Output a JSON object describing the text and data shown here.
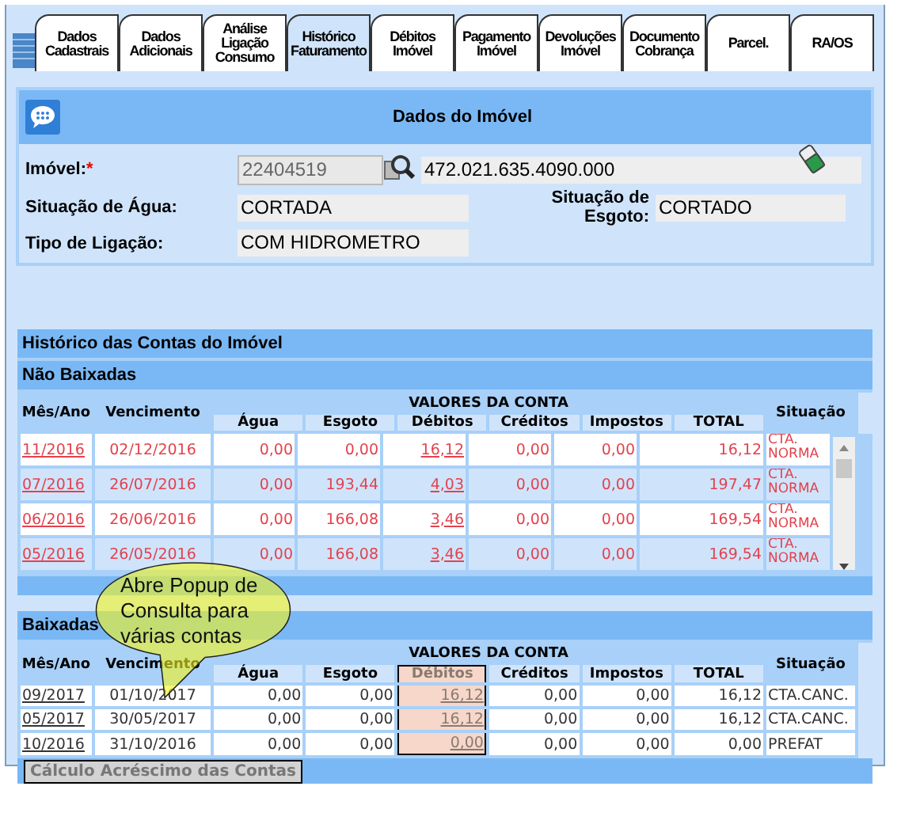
{
  "tabs": [
    {
      "label": "Dados\nCadastrais",
      "selected": false
    },
    {
      "label": "Dados\nAdicionais",
      "selected": false
    },
    {
      "label": "Análise\nLigação\nConsumo",
      "selected": false
    },
    {
      "label": "Histórico\nFaturamento",
      "selected": true
    },
    {
      "label": "Débitos\nImóvel",
      "selected": false
    },
    {
      "label": "Pagamento\nImóvel",
      "selected": false
    },
    {
      "label": "Devoluções\nImóvel",
      "selected": false
    },
    {
      "label": "Documento\nCobrança",
      "selected": false
    },
    {
      "label": "Parcel.",
      "selected": false
    },
    {
      "label": "RA/OS",
      "selected": false
    }
  ],
  "property": {
    "title": "Dados do Imóvel",
    "imovel": {
      "label": "Imóvel:",
      "required_mark": "*",
      "code": "22404519",
      "address": "472.021.635.4090.000"
    },
    "agua": {
      "label": "Situação de Água:",
      "value": "CORTADA"
    },
    "esgoto": {
      "label": "Situação de Esgoto:",
      "value": "CORTADO"
    },
    "ligacao": {
      "label": "Tipo de Ligação:",
      "value": "COM HIDROMETRO"
    }
  },
  "history": {
    "title": "Histórico das Contas do Imóvel",
    "sections": [
      {
        "title": "Não Baixadas",
        "kind": "pending",
        "group_label": "VALORES DA CONTA",
        "columns": [
          {
            "label": "Mês/Ano",
            "kind": "period",
            "highlighted": false
          },
          {
            "label": "Vencimento",
            "kind": "date",
            "highlighted": false
          },
          {
            "label": "Água",
            "kind": "amount",
            "highlighted": false
          },
          {
            "label": "Esgoto",
            "kind": "amount",
            "highlighted": false
          },
          {
            "label": "Débitos",
            "kind": "link_amount",
            "highlighted": false
          },
          {
            "label": "Créditos",
            "kind": "amount",
            "highlighted": false
          },
          {
            "label": "Impostos",
            "kind": "amount",
            "highlighted": false
          },
          {
            "label": "TOTAL",
            "kind": "amount",
            "highlighted": false
          },
          {
            "label": "Situação",
            "kind": "status",
            "highlighted": false
          }
        ],
        "rows": [
          {
            "cells": [
              "11/2016",
              "02/12/2016",
              "0,00",
              "0,00",
              "16,12",
              "0,00",
              "0,00",
              "16,12",
              "CTA. NORMA"
            ]
          },
          {
            "cells": [
              "07/2016",
              "26/07/2016",
              "0,00",
              "193,44",
              "4,03",
              "0,00",
              "0,00",
              "197,47",
              "CTA. NORMA"
            ]
          },
          {
            "cells": [
              "06/2016",
              "26/06/2016",
              "0,00",
              "166,08",
              "3,46",
              "0,00",
              "0,00",
              "169,54",
              "CTA. NORMA"
            ]
          },
          {
            "cells": [
              "05/2016",
              "26/05/2016",
              "0,00",
              "166,08",
              "3,46",
              "0,00",
              "0,00",
              "169,54",
              "CTA. NORMA"
            ]
          }
        ]
      },
      {
        "title": "Baixadas",
        "kind": "settled",
        "group_label": "VALORES DA CONTA",
        "columns": [
          {
            "label": "Mês/Ano",
            "kind": "period",
            "highlighted": false
          },
          {
            "label": "Vencimento",
            "kind": "date",
            "highlighted": false
          },
          {
            "label": "Água",
            "kind": "amount",
            "highlighted": false
          },
          {
            "label": "Esgoto",
            "kind": "amount",
            "highlighted": false
          },
          {
            "label": "Débitos",
            "kind": "link_amount",
            "highlighted": true
          },
          {
            "label": "Créditos",
            "kind": "amount",
            "highlighted": false
          },
          {
            "label": "Impostos",
            "kind": "amount",
            "highlighted": false
          },
          {
            "label": "TOTAL",
            "kind": "amount",
            "highlighted": false
          },
          {
            "label": "Situação",
            "kind": "status",
            "highlighted": false
          }
        ],
        "rows": [
          {
            "cells": [
              "09/2017",
              "01/10/2017",
              "0,00",
              "0,00",
              "16,12",
              "0,00",
              "0,00",
              "16,12",
              "CTA.CANC."
            ]
          },
          {
            "cells": [
              "05/2017",
              "30/05/2017",
              "0,00",
              "0,00",
              "16,12",
              "0,00",
              "0,00",
              "16,12",
              "CTA.CANC."
            ]
          },
          {
            "cells": [
              "10/2016",
              "31/10/2016",
              "0,00",
              "0,00",
              "0,00",
              "0,00",
              "0,00",
              "0,00",
              "PREFAT"
            ]
          }
        ]
      }
    ],
    "footer_link": "Cálculo Acréscimo das Contas"
  },
  "callout": {
    "text": "Abre Popup de Consulta para várias contas"
  }
}
